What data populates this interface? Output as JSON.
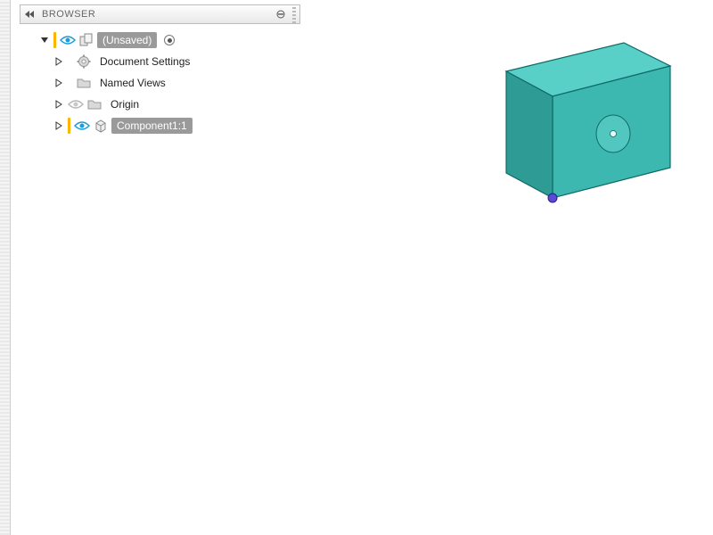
{
  "panel": {
    "title": "BROWSER"
  },
  "tree": {
    "root": {
      "label": "(Unsaved)"
    },
    "items": [
      {
        "label": "Document Settings"
      },
      {
        "label": "Named Views"
      },
      {
        "label": "Origin"
      },
      {
        "label": "Component1:1"
      }
    ]
  },
  "colors": {
    "solid_top": "#4bc9c0",
    "solid_front": "#3cb8b0",
    "solid_side": "#2e9b95",
    "edge": "#106a67"
  }
}
